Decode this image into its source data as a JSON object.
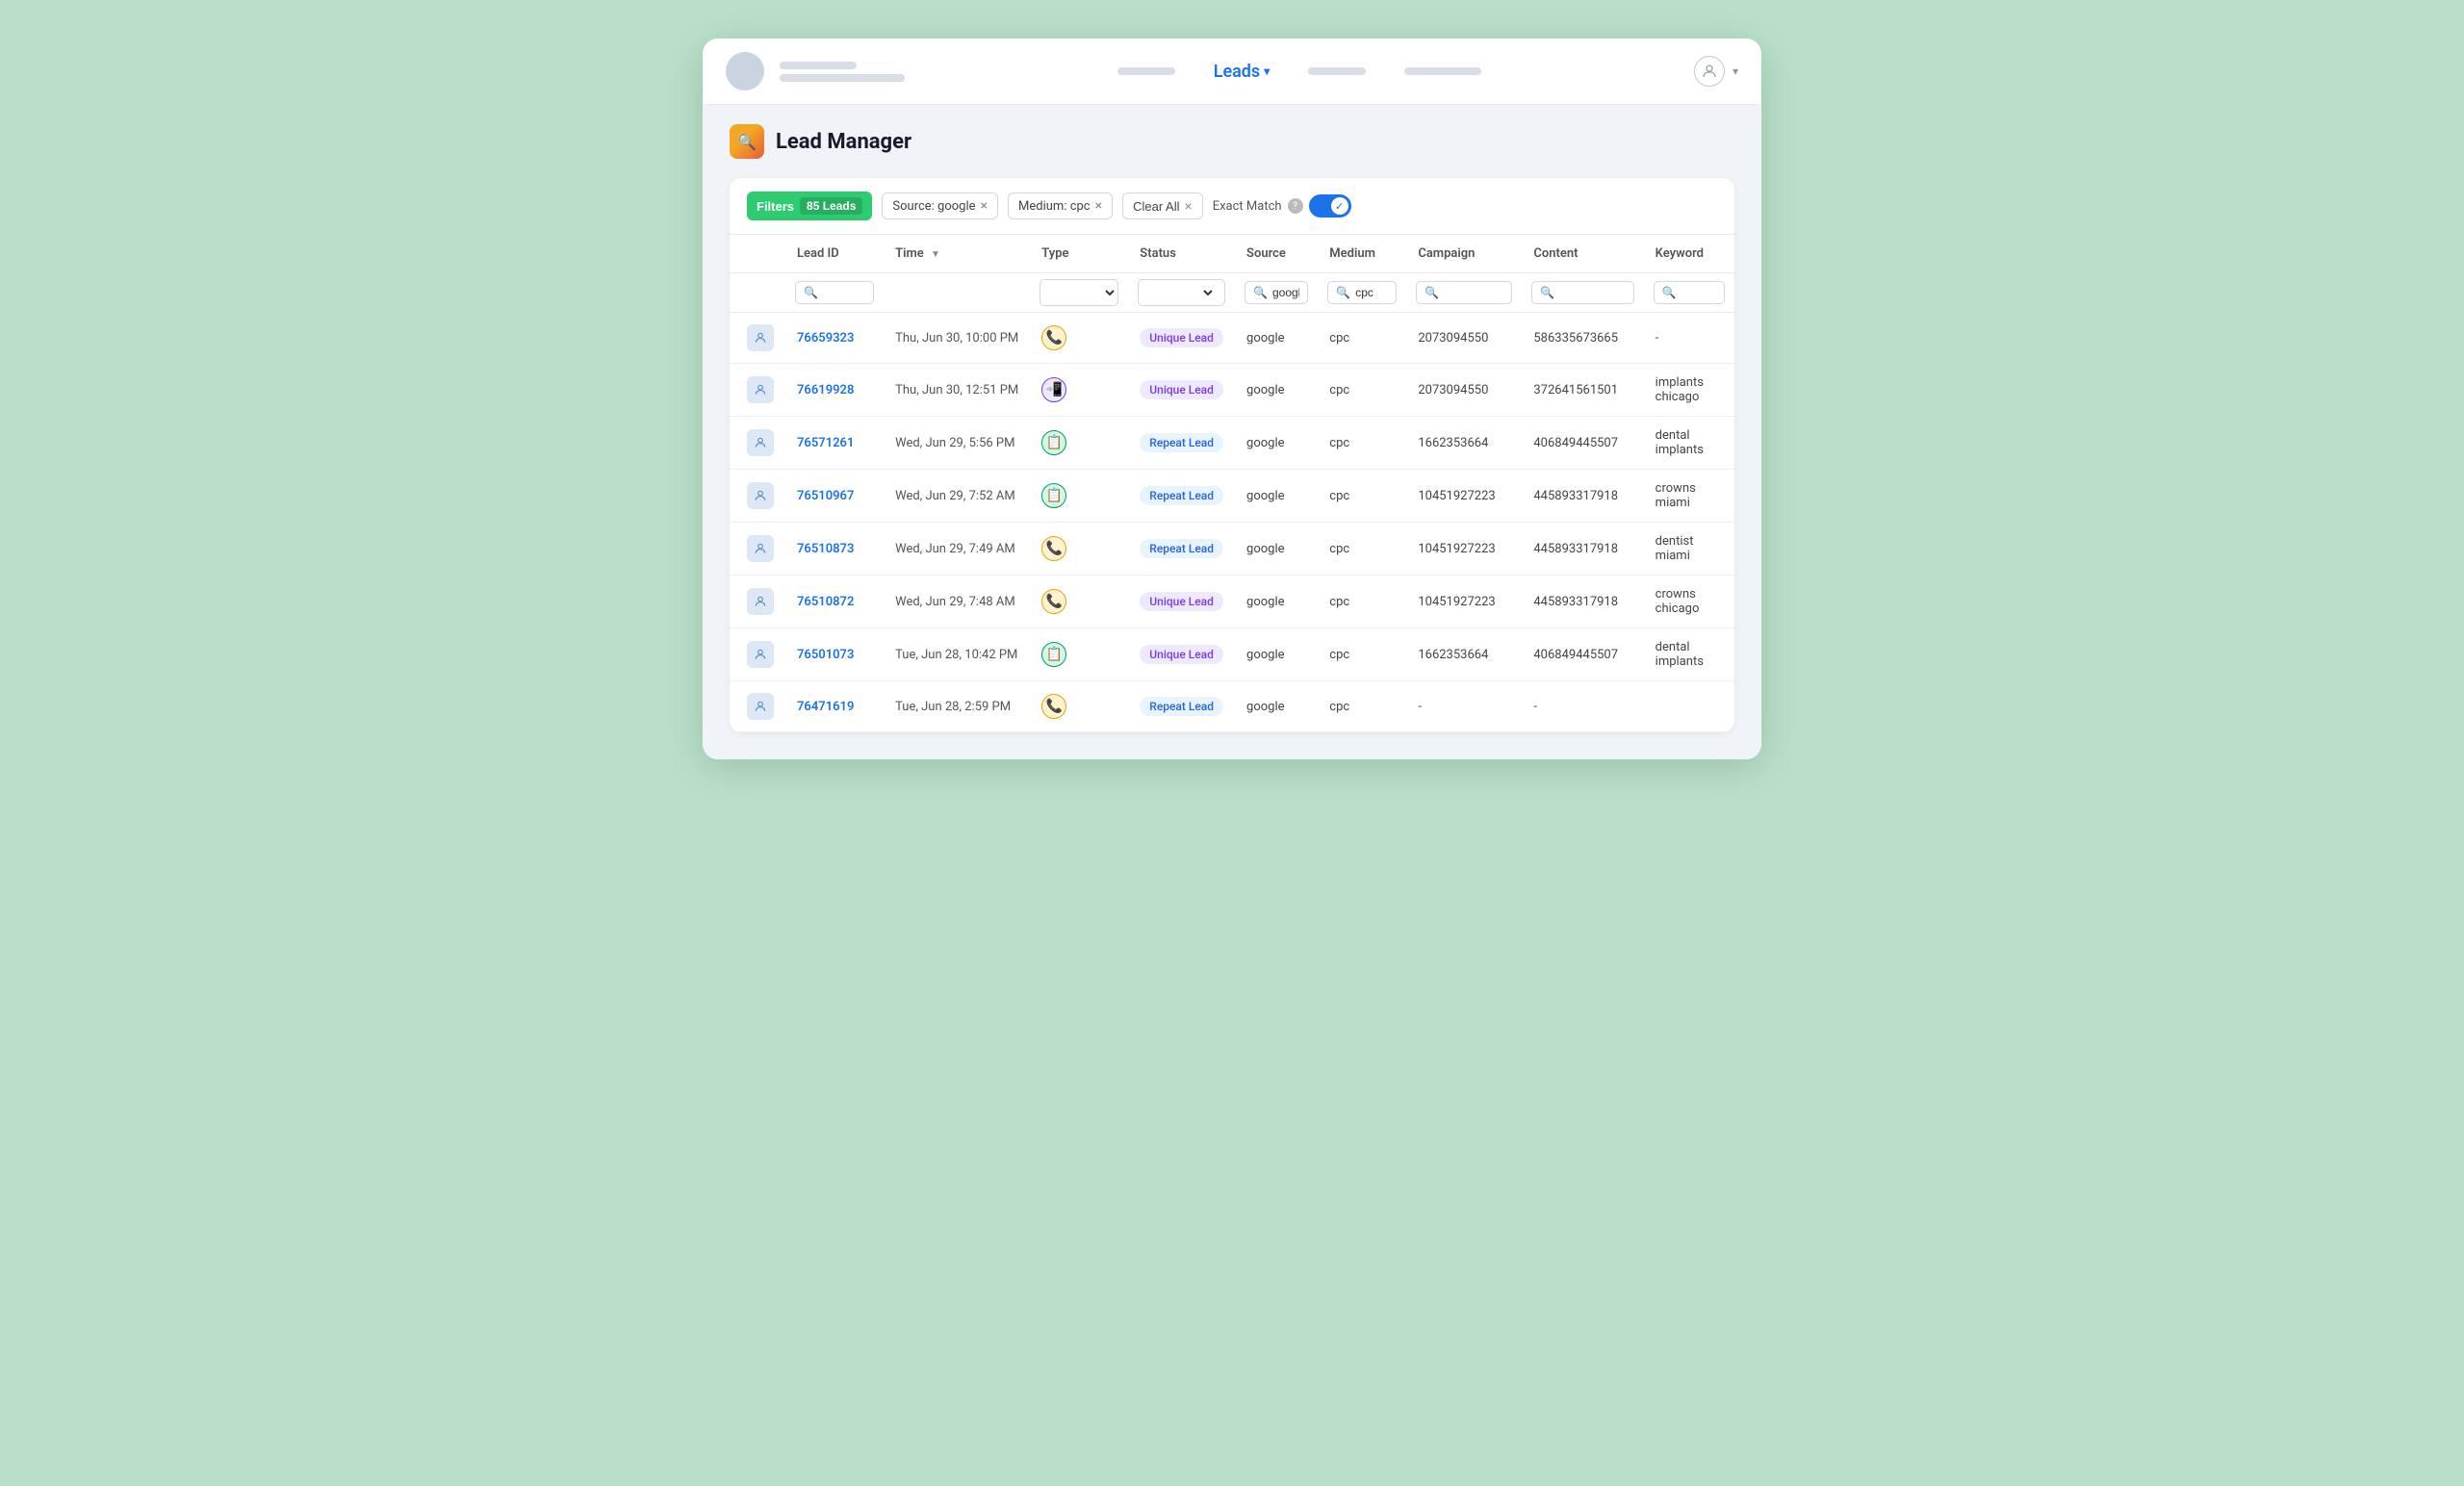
{
  "nav": {
    "title": "Leads",
    "title_caret": "▾",
    "avatar_label": "User avatar",
    "caret_label": "▾"
  },
  "page": {
    "title": "Lead Manager"
  },
  "filters": {
    "button_label": "Filters",
    "leads_count": "85 Leads",
    "source_tag": "Source: google",
    "medium_tag": "Medium: cpc",
    "clear_all_label": "Clear All",
    "exact_match_label": "Exact Match",
    "toggle_on": true
  },
  "table": {
    "columns": [
      "",
      "Lead ID",
      "Time",
      "Type",
      "Status",
      "Source",
      "Medium",
      "Campaign",
      "Content",
      "Keyword"
    ],
    "search_placeholders": {
      "lead_id": "",
      "type": "",
      "status": "",
      "source": "google",
      "medium": "cpc",
      "campaign": "",
      "content": "",
      "keyword": ""
    },
    "rows": [
      {
        "id": "76659323",
        "time": "Thu, Jun 30, 10:00 PM",
        "type_icon": "📞",
        "status": "Unique Lead",
        "status_type": "unique",
        "source": "google",
        "medium": "cpc",
        "campaign": "2073094550",
        "content": "586335673665",
        "keyword": "-"
      },
      {
        "id": "76619928",
        "time": "Thu, Jun 30, 12:51 PM",
        "type_icon": "📲",
        "status": "Unique Lead",
        "status_type": "unique",
        "source": "google",
        "medium": "cpc",
        "campaign": "2073094550",
        "content": "372641561501",
        "keyword": "implants chicago"
      },
      {
        "id": "76571261",
        "time": "Wed, Jun 29, 5:56 PM",
        "type_icon": "📋",
        "status": "Repeat Lead",
        "status_type": "repeat",
        "source": "google",
        "medium": "cpc",
        "campaign": "1662353664",
        "content": "406849445507",
        "keyword": "dental implants"
      },
      {
        "id": "76510967",
        "time": "Wed, Jun 29, 7:52 AM",
        "type_icon": "📋",
        "status": "Repeat Lead",
        "status_type": "repeat",
        "source": "google",
        "medium": "cpc",
        "campaign": "10451927223",
        "content": "445893317918",
        "keyword": "crowns miami"
      },
      {
        "id": "76510873",
        "time": "Wed, Jun 29, 7:49 AM",
        "type_icon": "📞",
        "status": "Repeat Lead",
        "status_type": "repeat",
        "source": "google",
        "medium": "cpc",
        "campaign": "10451927223",
        "content": "445893317918",
        "keyword": "dentist miami"
      },
      {
        "id": "76510872",
        "time": "Wed, Jun 29, 7:48 AM",
        "type_icon": "📞",
        "status": "Unique Lead",
        "status_type": "unique",
        "source": "google",
        "medium": "cpc",
        "campaign": "10451927223",
        "content": "445893317918",
        "keyword": "crowns chicago"
      },
      {
        "id": "76501073",
        "time": "Tue, Jun 28, 10:42 PM",
        "type_icon": "📋",
        "status": "Unique Lead",
        "status_type": "unique",
        "source": "google",
        "medium": "cpc",
        "campaign": "1662353664",
        "content": "406849445507",
        "keyword": "dental implants"
      },
      {
        "id": "76471619",
        "time": "Tue, Jun 28, 2:59 PM",
        "type_icon": "📞",
        "status": "Repeat Lead",
        "status_type": "repeat",
        "source": "google",
        "medium": "cpc",
        "campaign": "-",
        "content": "-",
        "keyword": ""
      }
    ]
  }
}
